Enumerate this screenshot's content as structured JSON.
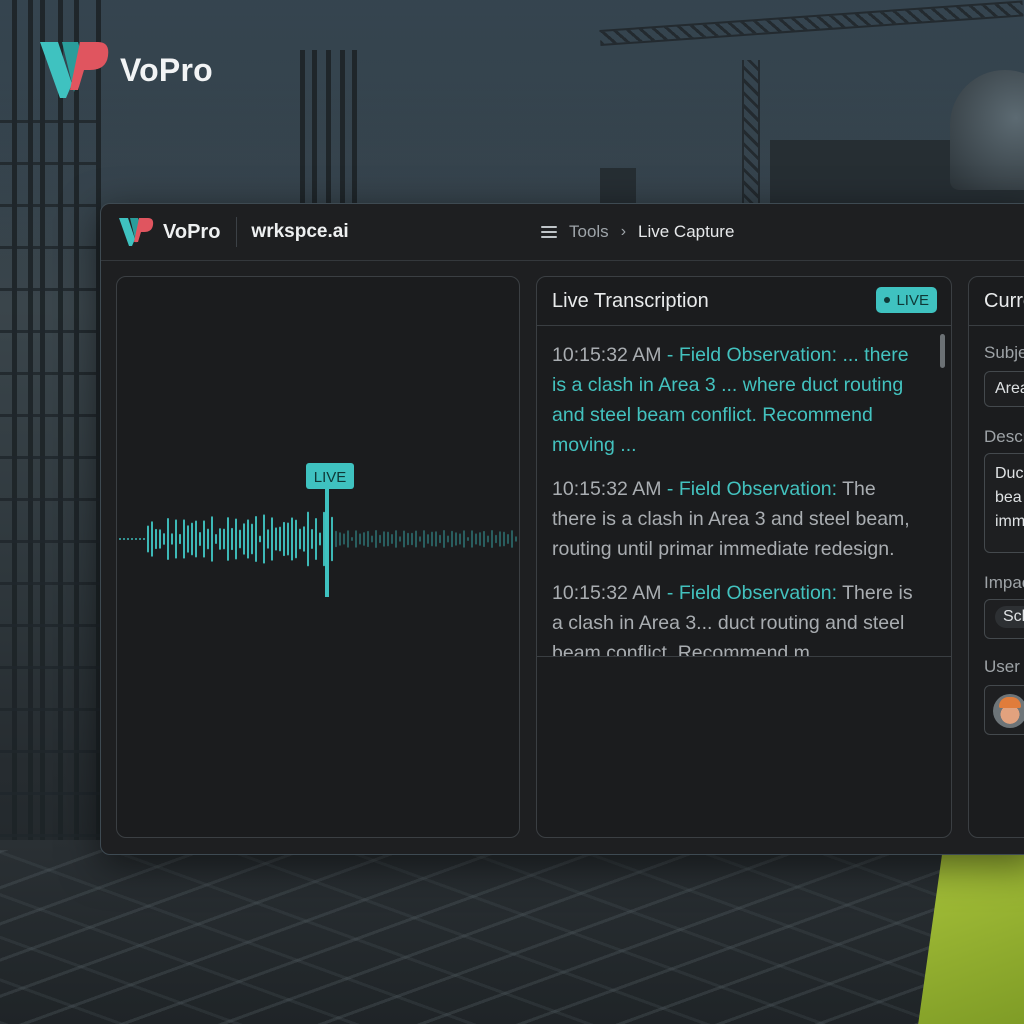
{
  "brand": {
    "name": "VoPro",
    "logo_colors": {
      "teal": "#3fc2c0",
      "red": "#e0555f"
    }
  },
  "header": {
    "brand_name": "VoPro",
    "workspace": "wrkspce.ai",
    "menu_icon": "hamburger-menu-icon",
    "breadcrumb": {
      "parent": "Tools",
      "separator": "›",
      "current": "Live Capture"
    }
  },
  "waveform": {
    "marker_label": "LIVE",
    "accent": "#3fc2c0"
  },
  "transcription": {
    "title": "Live Transcription",
    "badge": "LIVE",
    "entries": [
      {
        "time": "10:15:32 AM",
        "tag": " - Field Observation: ...",
        "text": " there is a clash in Area 3 ... where duct routing and steel beam conflict. Recommend moving ...",
        "text_highlight": true
      },
      {
        "time": "10:15:32 AM",
        "tag": " - Field Observation:",
        "text": " The there is a clash in Area 3 and steel beam, routing until primar immediate redesign.",
        "text_highlight": false
      },
      {
        "time": "10:15:32 AM",
        "tag": " - Field Observation:",
        "text": " There is a clash in Area 3... duct routing and steel beam conflict. Recommend m",
        "text_highlight": false
      }
    ]
  },
  "current": {
    "title": "Curre",
    "subject_label": "Subje",
    "subject_value": "Area",
    "description_label": "Descr",
    "description_lines": [
      "Duc",
      "bea",
      "imm"
    ],
    "impact_label": "Impac",
    "impact_chip": "Sch",
    "user_label": "User",
    "user_avatar_icon": "worker-avatar-icon"
  }
}
